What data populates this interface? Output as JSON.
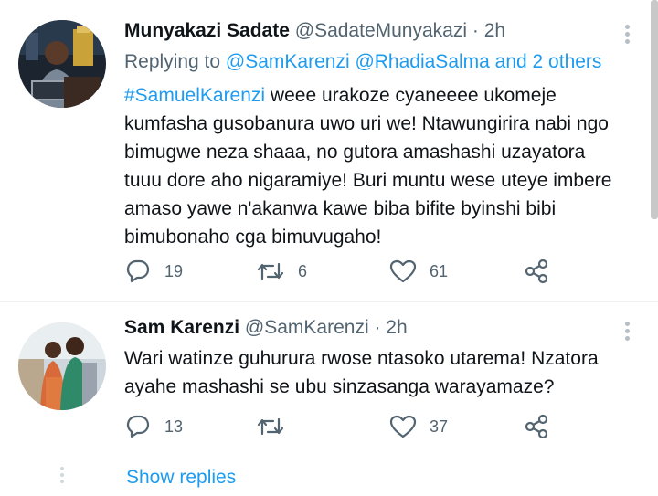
{
  "tweets": [
    {
      "display_name": "Munyakazi Sadate",
      "handle": "@SadateMunyakazi",
      "separator": "·",
      "time": "2h",
      "replying_prefix": "Replying to",
      "replying_to": "@SamKarenzi @RhadiaSalma and 2 others",
      "hashtag": "#SamuelKarenzi",
      "lines": [
        " weee urakoze cyaneeee ukomeje",
        "kumfasha gusobanura uwo uri we! Ntawungirira nabi ngo",
        "bimugwe neza shaaa, no gutora amashashi uzayatora",
        "tuuu dore aho nigaramiye! Buri muntu wese uteye imbere",
        "amaso yawe n'akanwa kawe biba bifite byinshi bibi",
        "bimubonaho cga bimuvugaho!"
      ],
      "replies": "19",
      "retweets": "6",
      "likes": "61"
    },
    {
      "display_name": "Sam Karenzi",
      "handle": "@SamKarenzi",
      "separator": "·",
      "time": "2h",
      "lines": [
        "Wari watinze guhurura rwose ntasoko utarema! Nzatora",
        "ayahe mashashi se ubu sinzasanga warayamaze?"
      ],
      "replies": "13",
      "retweets": "",
      "likes": "37"
    }
  ],
  "show_replies_label": "Show replies",
  "icons": {
    "reply": "reply-icon",
    "retweet": "retweet-icon",
    "like": "heart-icon",
    "share": "share-icon",
    "more": "more-icon"
  },
  "colors": {
    "link": "#1d9bf0",
    "meta": "#536471",
    "text": "#0f1419"
  }
}
